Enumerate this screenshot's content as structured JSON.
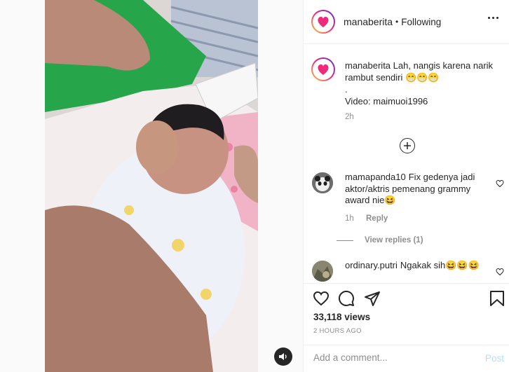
{
  "post": {
    "username": "manaberita",
    "follow_separator": "•",
    "follow_status": "Following",
    "logo_text": "manaberita"
  },
  "caption": {
    "username": "manaberita",
    "text_line1": "Lah, nangis karena narik rambut sendiri 😁😁😁",
    "text_line2": ".",
    "text_line3": "Video: maimuoi1996",
    "time": "2h"
  },
  "comments": [
    {
      "username": "mamapanda10",
      "text": "Fix gedenya jadi aktor/aktris pemenang grammy award nie😆",
      "time": "1h",
      "reply_label": "Reply",
      "view_replies": "View replies (1)"
    },
    {
      "username": "ordinary.putri",
      "text": "Ngakak sih😆😆😆"
    }
  ],
  "stats": {
    "views": "33,118 views",
    "ago": "2 HOURS AGO"
  },
  "composer": {
    "placeholder": "Add a comment...",
    "post_label": "Post"
  },
  "colors": {
    "text": "#262626",
    "muted": "#8e8e8e",
    "post_disabled": "#b2dffc",
    "brand_gradient_start": "#ee2a7b"
  },
  "icons": [
    "sound-icon",
    "more-options-icon",
    "load-more-icon",
    "heart-icon",
    "comment-icon",
    "share-icon",
    "bookmark-icon"
  ]
}
